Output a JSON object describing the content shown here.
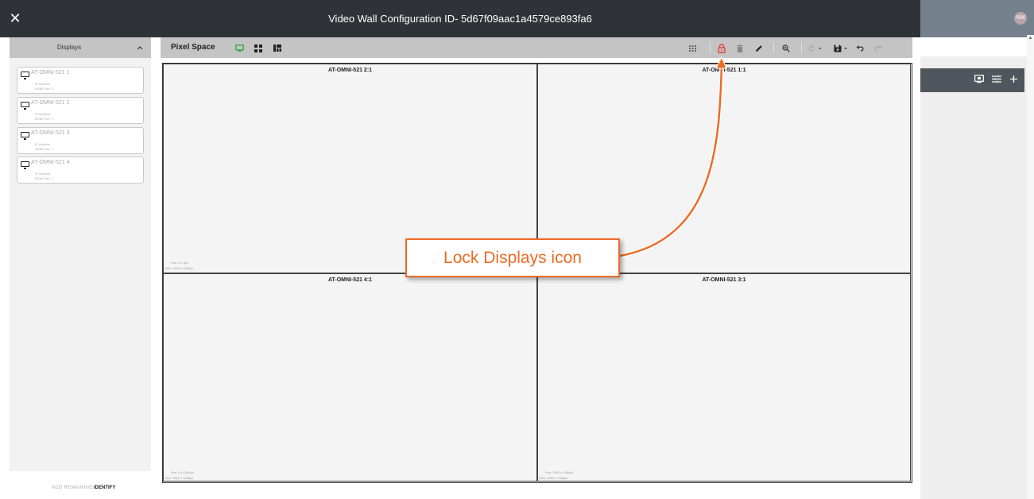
{
  "dialog": {
    "title": "Video Wall Configuration ID- 5d67f09aac1a4579ce893fa6",
    "close_glyph": "✕"
  },
  "background_app": {
    "avatar_initials": "NM"
  },
  "displays_panel": {
    "title": "Displays",
    "items": [
      {
        "name": "AT-OMNI-521 1",
        "ip_label": "IP Address",
        "hdmi_label": "HDMI Port",
        "hdmi_value": "1"
      },
      {
        "name": "AT-OMNI-521 2",
        "ip_label": "IP Address",
        "hdmi_label": "HDMI Port",
        "hdmi_value": "1"
      },
      {
        "name": "AT-OMNI-521 3",
        "ip_label": "IP Address",
        "hdmi_label": "HDMI Port",
        "hdmi_value": "1"
      },
      {
        "name": "AT-OMNI-521 4",
        "ip_label": "IP Address",
        "hdmi_label": "HDMI Port",
        "hdmi_value": "1"
      }
    ],
    "add_remaining": "ADD REMAINING",
    "identify": "IDENTIFY"
  },
  "pixel_space": {
    "title": "Pixel Space",
    "cells": [
      {
        "label": "AT-OMNI-521 2:1",
        "pos": "Pos: 0 x 0px",
        "size": "Size: 1920 x 1080px"
      },
      {
        "label": "AT-OMNI-521 1:1",
        "pos": "",
        "size": ""
      },
      {
        "label": "AT-OMNI-521 4:1",
        "pos": "Pos: 0 x 1080px",
        "size": "Size: 1920 x 1080px"
      },
      {
        "label": "AT-OMNI-521 3:1",
        "pos": "Pos: 1920 x 1080px",
        "size": "Size: 1920 x 1080px"
      }
    ]
  },
  "annotation": {
    "text": "Lock Displays icon",
    "color": "#ee6a24"
  },
  "colors": {
    "topbar": "#2f3338",
    "lock_icon": "#e53935",
    "monitor_icon_active": "#3aa845"
  }
}
